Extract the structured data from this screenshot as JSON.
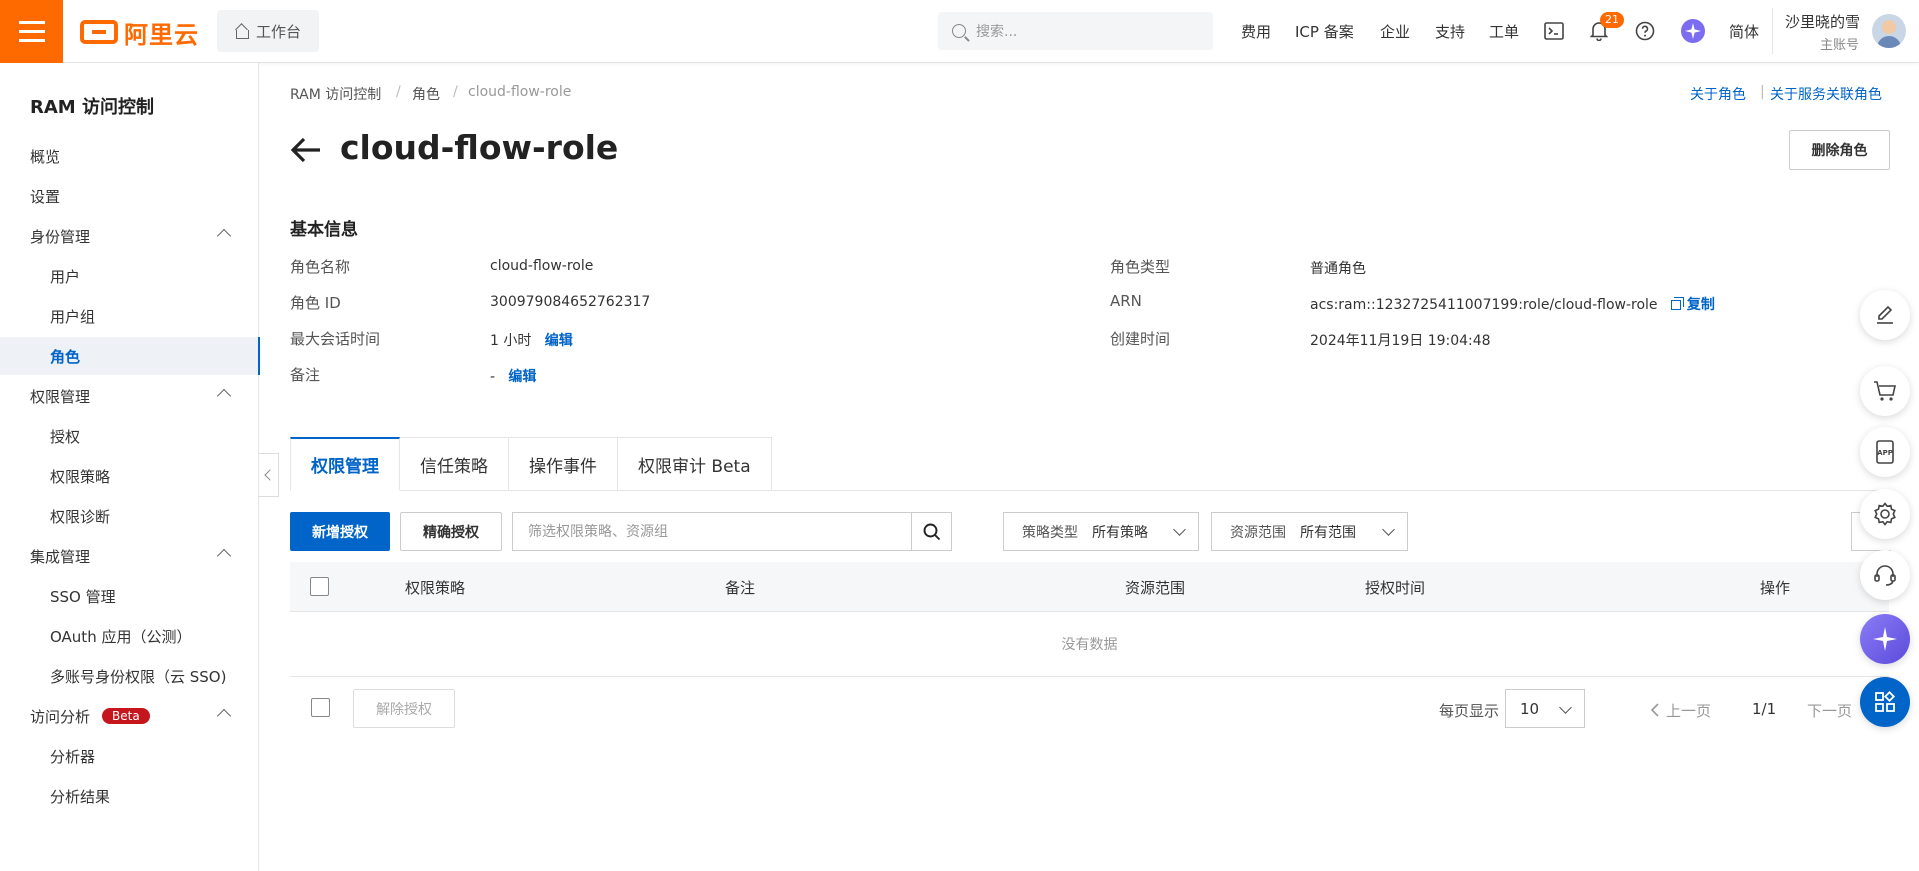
{
  "topbar": {
    "logo_text": "阿里云",
    "workbench": "工作台",
    "search_placeholder": "搜索...",
    "nav": [
      "费用",
      "ICP 备案",
      "企业",
      "支持",
      "工单"
    ],
    "notification_count": "21",
    "language": "简体",
    "user_name": "沙里晓的雪",
    "user_role": "主账号"
  },
  "sidebar": {
    "title": "RAM 访问控制",
    "items": [
      {
        "label": "概览"
      },
      {
        "label": "设置"
      },
      {
        "label": "身份管理"
      },
      {
        "label": "用户"
      },
      {
        "label": "用户组"
      },
      {
        "label": "角色"
      },
      {
        "label": "权限管理"
      },
      {
        "label": "授权"
      },
      {
        "label": "权限策略"
      },
      {
        "label": "权限诊断"
      },
      {
        "label": "集成管理"
      },
      {
        "label": "SSO 管理"
      },
      {
        "label": "OAuth 应用（公测）"
      },
      {
        "label": "多账号身份权限（云 SSO)"
      },
      {
        "label": "访问分析"
      },
      {
        "label": "分析器"
      },
      {
        "label": "分析结果"
      }
    ],
    "beta_badge": "Beta"
  },
  "breadcrumb": [
    "RAM 访问控制",
    "角色",
    "cloud-flow-role"
  ],
  "help_links": [
    "关于角色",
    "关于服务关联角色"
  ],
  "page_title": "cloud-flow-role",
  "delete_button": "删除角色",
  "basic_info": {
    "title": "基本信息",
    "role_name_label": "角色名称",
    "role_name": "cloud-flow-role",
    "role_id_label": "角色 ID",
    "role_id": "300979084652762317",
    "max_session_label": "最大会话时间",
    "max_session": "1 小时",
    "note_label": "备注",
    "note": "-",
    "edit": "编辑",
    "role_type_label": "角色类型",
    "role_type": "普通角色",
    "arn_label": "ARN",
    "arn": "acs:ram::1232725411007199:role/cloud-flow-role",
    "copy": "复制",
    "created_label": "创建时间",
    "created": "2024年11月19日 19:04:48"
  },
  "tabs": [
    "权限管理",
    "信任策略",
    "操作事件",
    "权限审计 Beta"
  ],
  "toolbar": {
    "add_grant": "新增授权",
    "precise_grant": "精确授权",
    "filter_placeholder": "筛选权限策略、资源组",
    "policy_type_label": "策略类型",
    "policy_type_value": "所有策略",
    "scope_label": "资源范围",
    "scope_value": "所有范围"
  },
  "table": {
    "headers": [
      "权限策略",
      "备注",
      "资源范围",
      "授权时间",
      "操作"
    ],
    "empty_text": "没有数据"
  },
  "footer": {
    "revoke": "解除授权",
    "page_size_label": "每页显示",
    "page_size": "10",
    "prev": "上一页",
    "page_count": "1/1",
    "next": "下一页"
  }
}
